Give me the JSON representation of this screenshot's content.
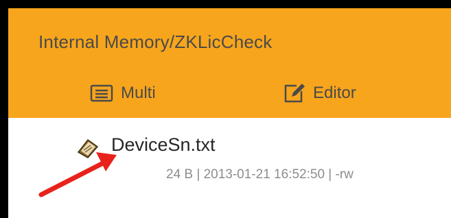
{
  "header": {
    "path": "Internal Memory/ZKLicCheck",
    "toolbar": {
      "multi_label": "Multi",
      "editor_label": "Editor"
    },
    "accent_color": "#f7a51c"
  },
  "files": [
    {
      "name": "DeviceSn.txt",
      "meta": "24 B | 2013-01-21 16:52:50 | -rw",
      "icon": "text-file-icon"
    }
  ],
  "annotation": {
    "arrow_color": "#e8231b"
  }
}
